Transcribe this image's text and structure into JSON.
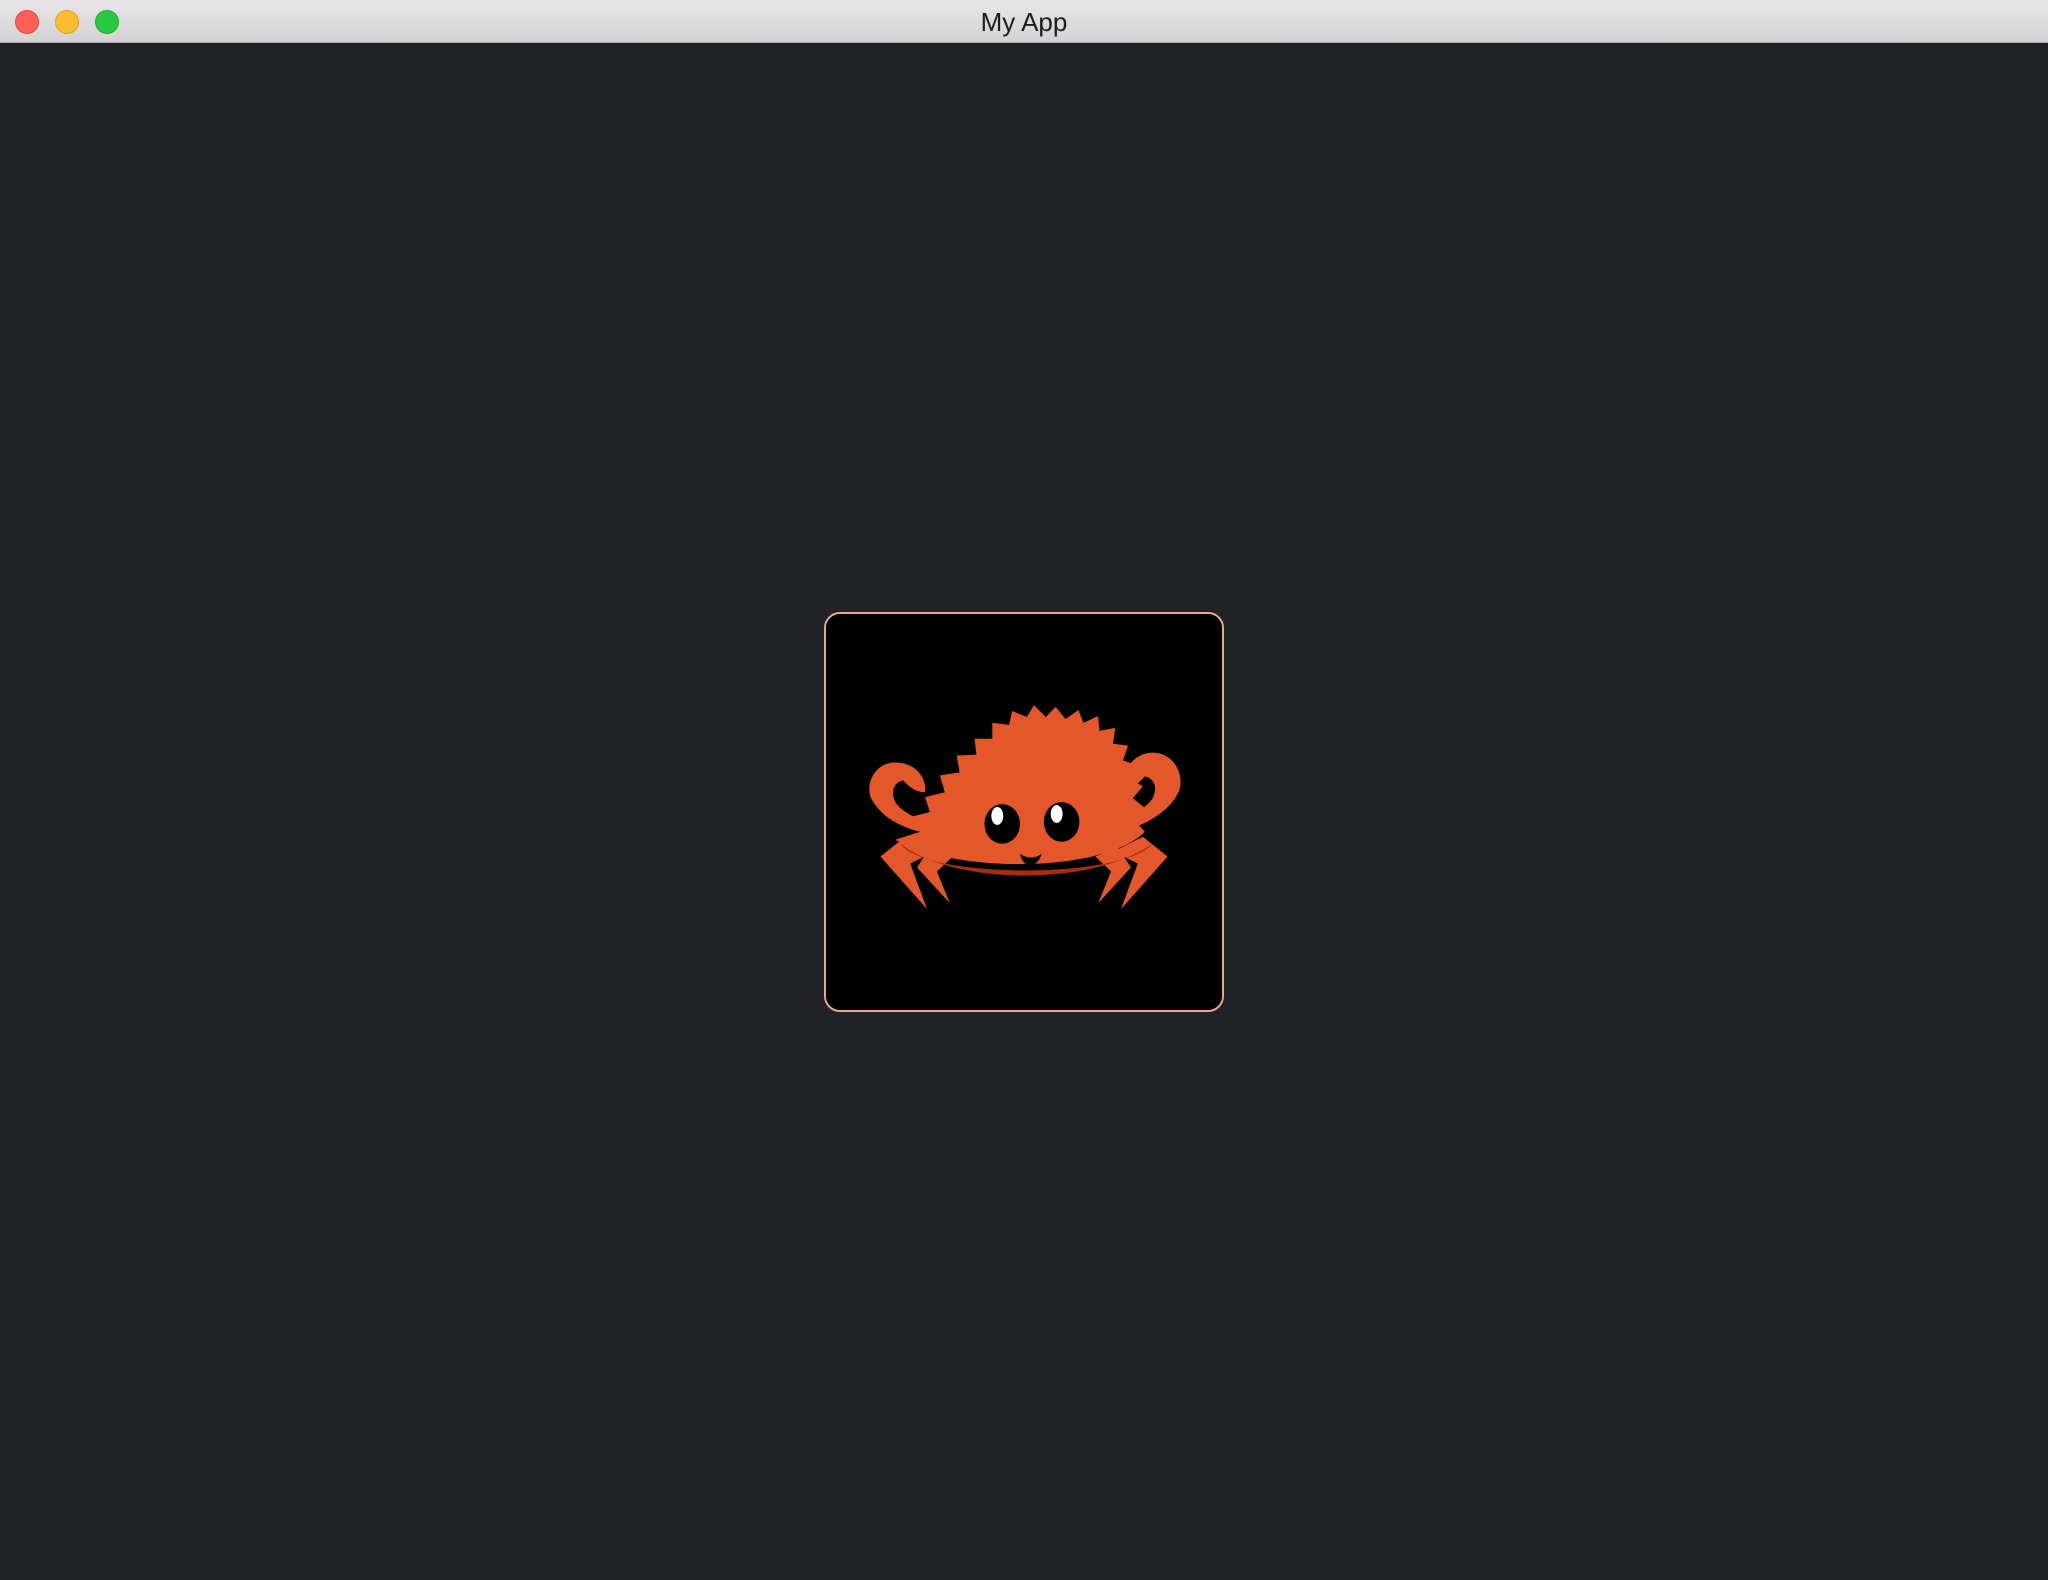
{
  "window": {
    "title": "My App"
  },
  "image": {
    "icon": "ferris-crab-icon",
    "colors": {
      "body": "#e4572a",
      "shadow": "#a52d10",
      "background": "#000000",
      "border": "#f0a58f",
      "eye": "#000000",
      "eye_highlight": "#ffffff"
    }
  }
}
